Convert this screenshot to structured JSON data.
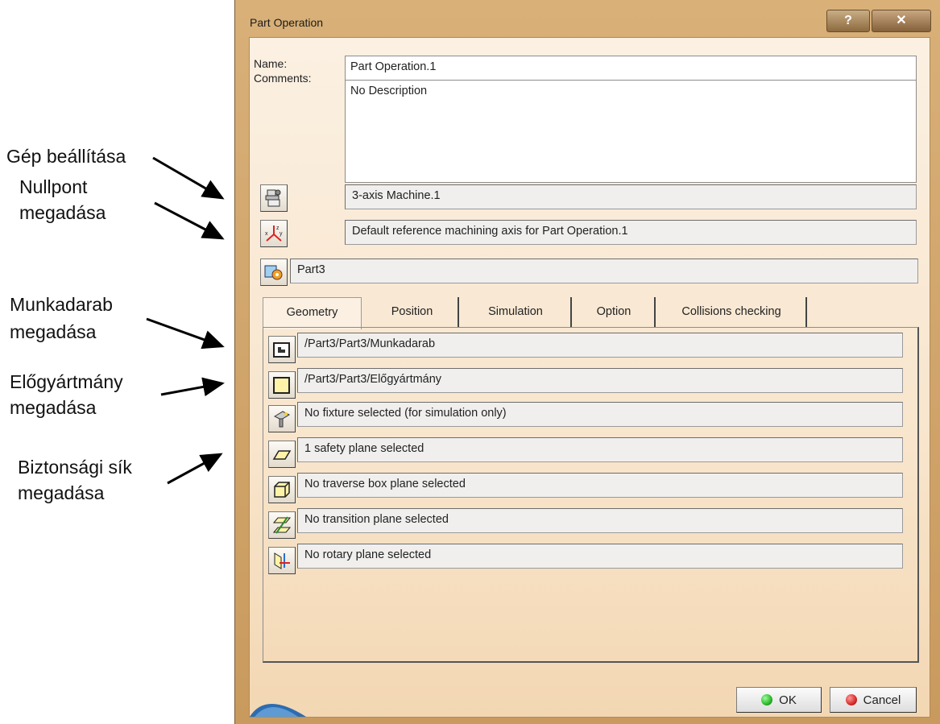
{
  "annotations": {
    "machine_setup": "Gép beállítása",
    "zero_point_1": "Nullpont",
    "zero_point_2": "megadása",
    "workpiece_1": "Munkadarab",
    "workpiece_2": "megadása",
    "stock_1": "Előgyártmány",
    "stock_2": "megadása",
    "safety_1": "Biztonsági sík",
    "safety_2": "megadása"
  },
  "window": {
    "title": "Part Operation",
    "help_label": "?",
    "close_label": "✕"
  },
  "form": {
    "name_label": "Name:",
    "name_value": "Part Operation.1",
    "comments_label": "Comments:",
    "comments_value": "No Description",
    "machine_value": "3-axis Machine.1",
    "axis_value": "Default reference machining axis for Part Operation.1",
    "product_value": "Part3"
  },
  "tabs": [
    {
      "label": "Geometry"
    },
    {
      "label": "Position"
    },
    {
      "label": "Simulation"
    },
    {
      "label": "Option"
    },
    {
      "label": "Collisions checking"
    }
  ],
  "geometry": [
    {
      "icon": "design-part-icon",
      "value": "/Part3/Part3/Munkadarab"
    },
    {
      "icon": "stock-icon",
      "value": "/Part3/Part3/Előgyártmány"
    },
    {
      "icon": "fixture-icon",
      "value": "No fixture selected (for simulation only)"
    },
    {
      "icon": "safety-plane-icon",
      "value": "1 safety plane selected"
    },
    {
      "icon": "traverse-box-icon",
      "value": "No traverse box plane selected"
    },
    {
      "icon": "transition-plane-icon",
      "value": "No transition plane selected"
    },
    {
      "icon": "rotary-plane-icon",
      "value": "No rotary plane selected"
    }
  ],
  "buttons": {
    "ok": "OK",
    "cancel": "Cancel",
    "ok_color": "#2bb52b",
    "cancel_color": "#d62b2b"
  }
}
